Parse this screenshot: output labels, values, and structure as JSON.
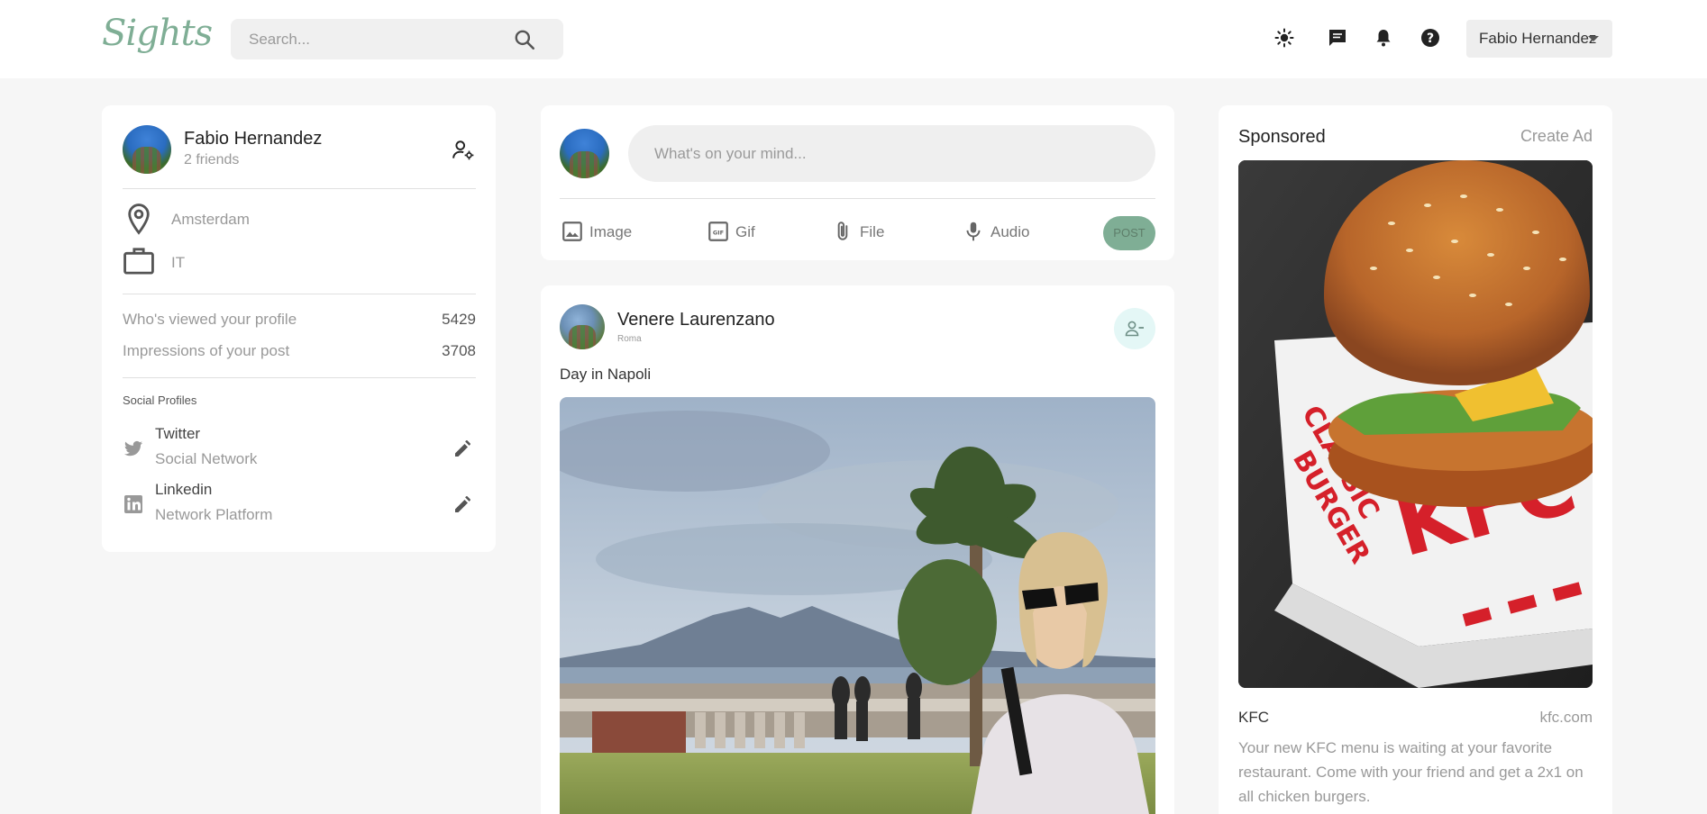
{
  "app": {
    "logo": "Sights"
  },
  "search": {
    "placeholder": "Search..."
  },
  "user_menu": {
    "name": "Fabio Hernandez"
  },
  "profile": {
    "name": "Fabio Hernandez",
    "friends": "2 friends",
    "location": "Amsterdam",
    "occupation": "IT",
    "stats": [
      {
        "label": "Who's viewed your profile",
        "value": "5429"
      },
      {
        "label": "Impressions of your post",
        "value": "3708"
      }
    ],
    "social_title": "Social Profiles",
    "socials": [
      {
        "name": "Twitter",
        "subtitle": "Social Network",
        "icon": "twitter-icon"
      },
      {
        "name": "Linkedin",
        "subtitle": "Network Platform",
        "icon": "linkedin-icon"
      }
    ]
  },
  "composer": {
    "placeholder": "What's on your mind...",
    "actions": [
      {
        "label": "Image",
        "icon": "image-icon"
      },
      {
        "label": "Gif",
        "icon": "gif-icon"
      },
      {
        "label": "File",
        "icon": "attachment-icon"
      },
      {
        "label": "Audio",
        "icon": "microphone-icon"
      }
    ],
    "post_label": "POST"
  },
  "post": {
    "author": "Venere Laurenzano",
    "location": "Roma",
    "text": "Day in Napoli"
  },
  "sponsored": {
    "title": "Sponsored",
    "create_label": "Create Ad",
    "brand": "KFC",
    "url": "kfc.com",
    "description": "Your new KFC menu is waiting at your favorite restaurant. Come with your friend and get a 2x1 on all chicken burgers.",
    "ad_image_text": [
      "CLASSIC",
      "BURGER",
      "KFC"
    ]
  },
  "colors": {
    "accent": "#7fae95",
    "background": "#f6f6f6",
    "card": "#ffffff",
    "unfriend_bg": "#e4f7f6"
  }
}
